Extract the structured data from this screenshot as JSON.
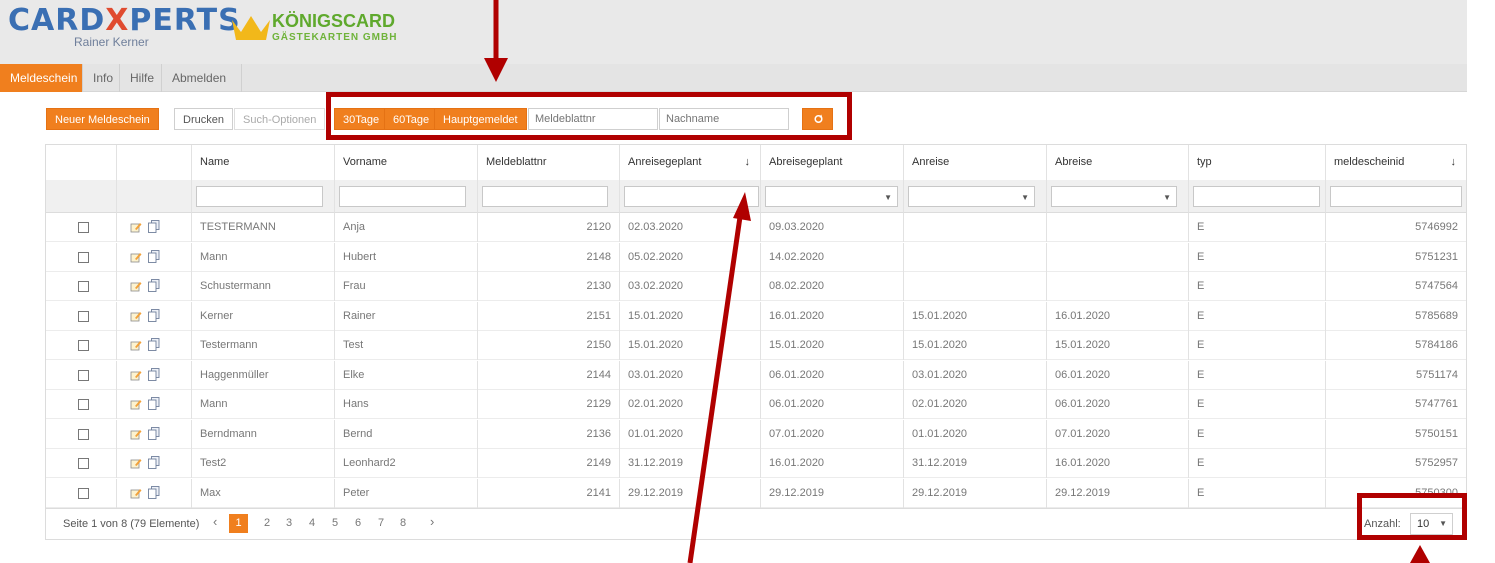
{
  "header": {
    "logo_main_left": "CARD",
    "logo_main_x": "X",
    "logo_main_right": "PERTS",
    "logo_sub": "Rainer Kerner",
    "logo_kg_title": "KÖNIGSCARD",
    "logo_kg_sub": "GÄSTEKARTEN GMBH"
  },
  "nav": [
    "Meldeschein",
    "Info",
    "Hilfe",
    "Abmelden"
  ],
  "toolbar": {
    "new_label": "Neuer Meldeschein",
    "print_label": "Drucken",
    "search_options_label": "Such-Optionen",
    "btn_30": "30Tage",
    "btn_60": "60Tage",
    "btn_haupt": "Hauptgemeldet",
    "meldeblatt_placeholder": "Meldeblattnr",
    "nachname_placeholder": "Nachname",
    "refresh_icon": "refresh-icon"
  },
  "columns": [
    "",
    "",
    "Name",
    "Vorname",
    "Meldeblattnr",
    "Anreisegeplant",
    "Abreisegeplant",
    "Anreise",
    "Abreise",
    "typ",
    "meldescheinid"
  ],
  "sort_indicator": "↓",
  "rows": [
    [
      "TESTERMANN",
      "Anja",
      "2120",
      "02.03.2020",
      "09.03.2020",
      "",
      "",
      "E",
      "5746992"
    ],
    [
      "Mann",
      "Hubert",
      "2148",
      "05.02.2020",
      "14.02.2020",
      "",
      "",
      "E",
      "5751231"
    ],
    [
      "Schustermann",
      "Frau",
      "2130",
      "03.02.2020",
      "08.02.2020",
      "",
      "",
      "E",
      "5747564"
    ],
    [
      "Kerner",
      "Rainer",
      "2151",
      "15.01.2020",
      "16.01.2020",
      "15.01.2020",
      "16.01.2020",
      "E",
      "5785689"
    ],
    [
      "Testermann",
      "Test",
      "2150",
      "15.01.2020",
      "15.01.2020",
      "15.01.2020",
      "15.01.2020",
      "E",
      "5784186"
    ],
    [
      "Haggenmüller",
      "Elke",
      "2144",
      "03.01.2020",
      "06.01.2020",
      "03.01.2020",
      "06.01.2020",
      "E",
      "5751174"
    ],
    [
      "Mann",
      "Hans",
      "2129",
      "02.01.2020",
      "06.01.2020",
      "02.01.2020",
      "06.01.2020",
      "E",
      "5747761"
    ],
    [
      "Berndmann",
      "Bernd",
      "2136",
      "01.01.2020",
      "07.01.2020",
      "01.01.2020",
      "07.01.2020",
      "E",
      "5750151"
    ],
    [
      "Test2",
      "Leonhard2",
      "2149",
      "31.12.2019",
      "16.01.2020",
      "31.12.2019",
      "16.01.2020",
      "E",
      "5752957"
    ],
    [
      "Max",
      "Peter",
      "2141",
      "29.12.2019",
      "29.12.2019",
      "29.12.2019",
      "29.12.2019",
      "E",
      "5750300"
    ]
  ],
  "pager": {
    "info": "Seite 1 von 8 (79 Elemente)",
    "prev": "‹",
    "next": "›",
    "pages": [
      "1",
      "2",
      "3",
      "4",
      "5",
      "6",
      "7",
      "8"
    ],
    "active_page": "1",
    "anzahl_label": "Anzahl:",
    "anzahl_value": "10"
  },
  "colors": {
    "accent": "#f07f1e",
    "annotation_red": "#b00000"
  }
}
